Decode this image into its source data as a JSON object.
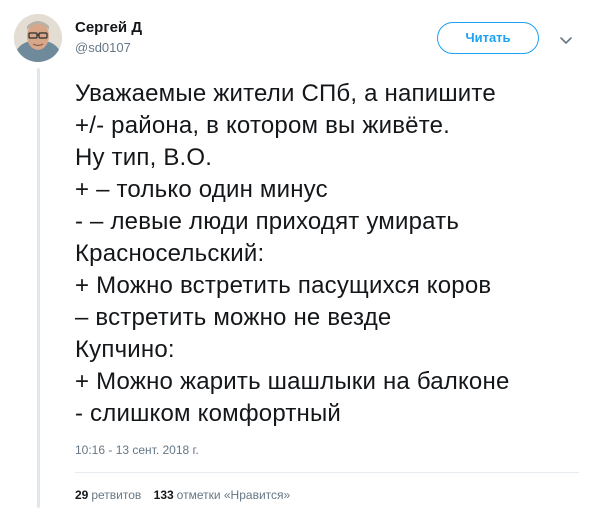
{
  "author": {
    "name": "Сергей Д",
    "handle": "@sd0107",
    "follow_label": "Читать"
  },
  "tweet": {
    "lines": [
      "Уважаемые жители СПб, а напишите",
      "+/- района, в котором вы живёте.",
      "Ну тип, В.О.",
      "+ – только один минус",
      "- – левые люди приходят умирать",
      "Красносельский:",
      "+ Можно встретить пасущихся коров",
      "– встретить можно не везде",
      "Купчино:",
      "+ Можно жарить шашлыки на балконе",
      "- слишком комфортный"
    ],
    "timestamp": "10:16 - 13 сент. 2018 г."
  },
  "stats": {
    "retweets_count": "29",
    "retweets_label": "ретвитов",
    "likes_count": "133",
    "likes_label": "отметки «Нравится»"
  },
  "colors": {
    "accent": "#1da1f2",
    "text": "#14171a",
    "muted": "#657786",
    "thread_line": "#e1e8ed"
  },
  "icons": {
    "caret": "chevron-down-icon"
  }
}
